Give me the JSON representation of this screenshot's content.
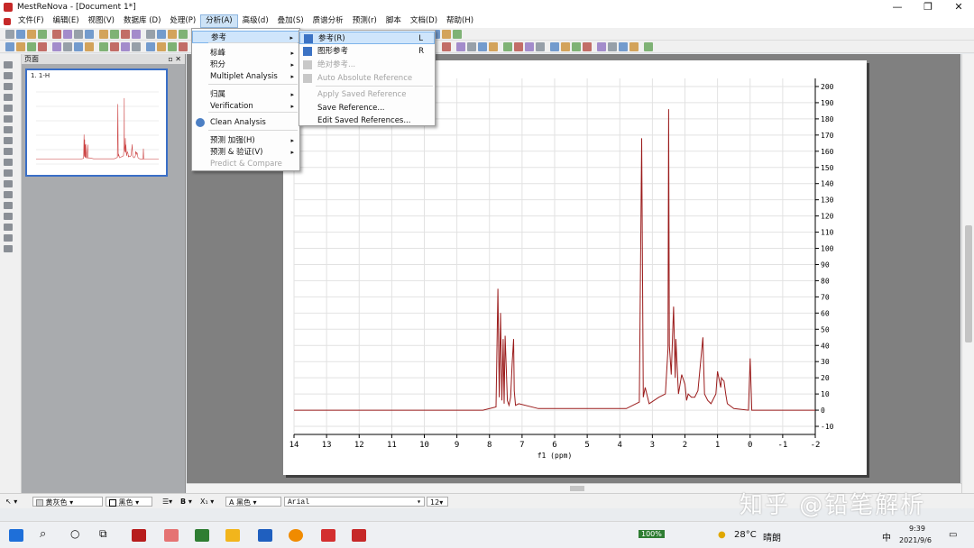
{
  "window": {
    "title": "MestReNova - [Document 1*]"
  },
  "menubar": {
    "items": [
      "文件(F)",
      "编辑(E)",
      "视图(V)",
      "数据库 (D)",
      "处理(P)",
      "分析(A)",
      "高级(d)",
      "叠加(S)",
      "质谱分析",
      "预测(r)",
      "脚本",
      "文档(D)",
      "帮助(H)"
    ],
    "active_index": 5
  },
  "pages_panel": {
    "header": "页面",
    "thumb_label": "1. 1-H"
  },
  "analysis_menu": {
    "items": [
      {
        "label": "参考",
        "submenu": true,
        "highlighted": true
      },
      {
        "label": "标峰",
        "submenu": true
      },
      {
        "label": "积分",
        "submenu": true
      },
      {
        "label": "Multiplet Analysis",
        "submenu": true
      },
      {
        "label": "归属",
        "submenu": true
      },
      {
        "label": "Verification",
        "submenu": true
      },
      {
        "label": "Clean Analysis",
        "submenu": false
      },
      {
        "label": "预测 加强(H)",
        "submenu": true
      },
      {
        "label": "预测 & 验证(V)",
        "submenu": true
      },
      {
        "label": "Predict & Compare",
        "submenu": false,
        "disabled": true
      }
    ]
  },
  "reference_submenu": {
    "items": [
      {
        "label": "参考(R)",
        "shortcut": "L",
        "highlighted": true
      },
      {
        "label": "图形参考",
        "shortcut": "R"
      },
      {
        "label": "绝对参考...",
        "disabled": true
      },
      {
        "label": "Auto Absolute Reference",
        "disabled": true
      },
      {
        "label": "Apply Saved Reference",
        "disabled": true
      },
      {
        "label": "Save Reference..."
      },
      {
        "label": "Edit Saved References..."
      }
    ]
  },
  "bottom_toolbar": {
    "fill_color": "黄灰色",
    "line_color": "黑色",
    "text_color": "黑色",
    "font": "Arial",
    "font_size": "12"
  },
  "taskbar": {
    "temperature": "28°C",
    "weather": "晴朗",
    "time": "9:39",
    "date": "2021/9/6",
    "ime": "中",
    "battery": "100%"
  },
  "watermark": "知乎 @铅笔解析",
  "colors": {
    "spectrum": "#9b1c1c",
    "highlight": "#cfe5fb"
  },
  "chart_data": {
    "type": "line",
    "title": "",
    "xlabel": "f1 (ppm)",
    "ylabel": "",
    "x_ticks": [
      14,
      13,
      12,
      11,
      10,
      9,
      8,
      7,
      6,
      5,
      4,
      3,
      2,
      1,
      0,
      -1,
      -2
    ],
    "y_ticks": [
      -10,
      0,
      10,
      20,
      30,
      40,
      50,
      60,
      70,
      80,
      90,
      100,
      110,
      120,
      130,
      140,
      150,
      160,
      170,
      180,
      190,
      200
    ],
    "xlim": [
      14.0,
      -2.0
    ],
    "ylim": [
      -15,
      205
    ],
    "x_reversed": true,
    "grid": true,
    "series": [
      {
        "x": [
          14.0,
          9.0,
          8.2,
          7.8,
          7.74,
          7.7,
          7.66,
          7.62,
          7.58,
          7.55,
          7.52,
          7.45,
          7.4,
          7.35,
          7.3,
          7.26,
          7.24,
          7.2,
          7.1,
          6.5,
          5.0,
          3.8,
          3.4,
          3.33,
          3.28,
          3.22,
          3.1,
          2.8,
          2.6,
          2.52,
          2.5,
          2.48,
          2.42,
          2.35,
          2.3,
          2.28,
          2.2,
          2.1,
          2.0,
          1.95,
          1.9,
          1.8,
          1.7,
          1.6,
          1.45,
          1.43,
          1.4,
          1.3,
          1.2,
          1.05,
          1.0,
          0.9,
          0.88,
          0.85,
          0.8,
          0.75,
          0.7,
          0.5,
          0.05,
          0.0,
          -0.05,
          -0.5,
          -2.0
        ],
        "y": [
          0,
          0,
          0,
          2,
          75,
          8,
          60,
          6,
          44,
          4,
          46,
          6,
          3,
          8,
          30,
          44,
          12,
          3,
          4,
          1,
          1,
          1,
          5,
          168,
          8,
          14,
          4,
          8,
          10,
          38,
          186,
          40,
          22,
          64,
          20,
          44,
          10,
          22,
          16,
          6,
          10,
          8,
          8,
          12,
          45,
          30,
          10,
          6,
          4,
          10,
          24,
          14,
          20,
          19,
          18,
          10,
          4,
          1,
          0,
          32,
          0,
          0,
          0
        ]
      }
    ]
  }
}
